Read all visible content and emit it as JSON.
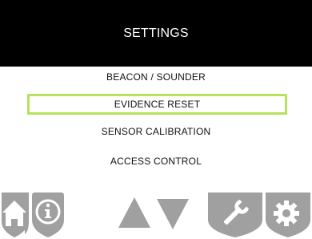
{
  "header": {
    "title": "SETTINGS"
  },
  "menu": {
    "items": [
      {
        "label": "BEACON / SOUNDER",
        "selected": false
      },
      {
        "label": "EVIDENCE RESET",
        "selected": true
      },
      {
        "label": "SENSOR CALIBRATION",
        "selected": false
      },
      {
        "label": "ACCESS CONTROL",
        "selected": false
      }
    ]
  },
  "footer": {
    "buttons": [
      {
        "icon": "home-icon"
      },
      {
        "icon": "info-icon"
      },
      {
        "icon": "up-arrow-icon"
      },
      {
        "icon": "down-arrow-icon"
      },
      {
        "icon": "wrench-icon"
      },
      {
        "icon": "gear-icon"
      }
    ]
  },
  "colors": {
    "header_bg": "#000000",
    "header_text": "#ffffff",
    "selection_border": "#b5e35b",
    "icon_fill": "#a0a0a0"
  }
}
